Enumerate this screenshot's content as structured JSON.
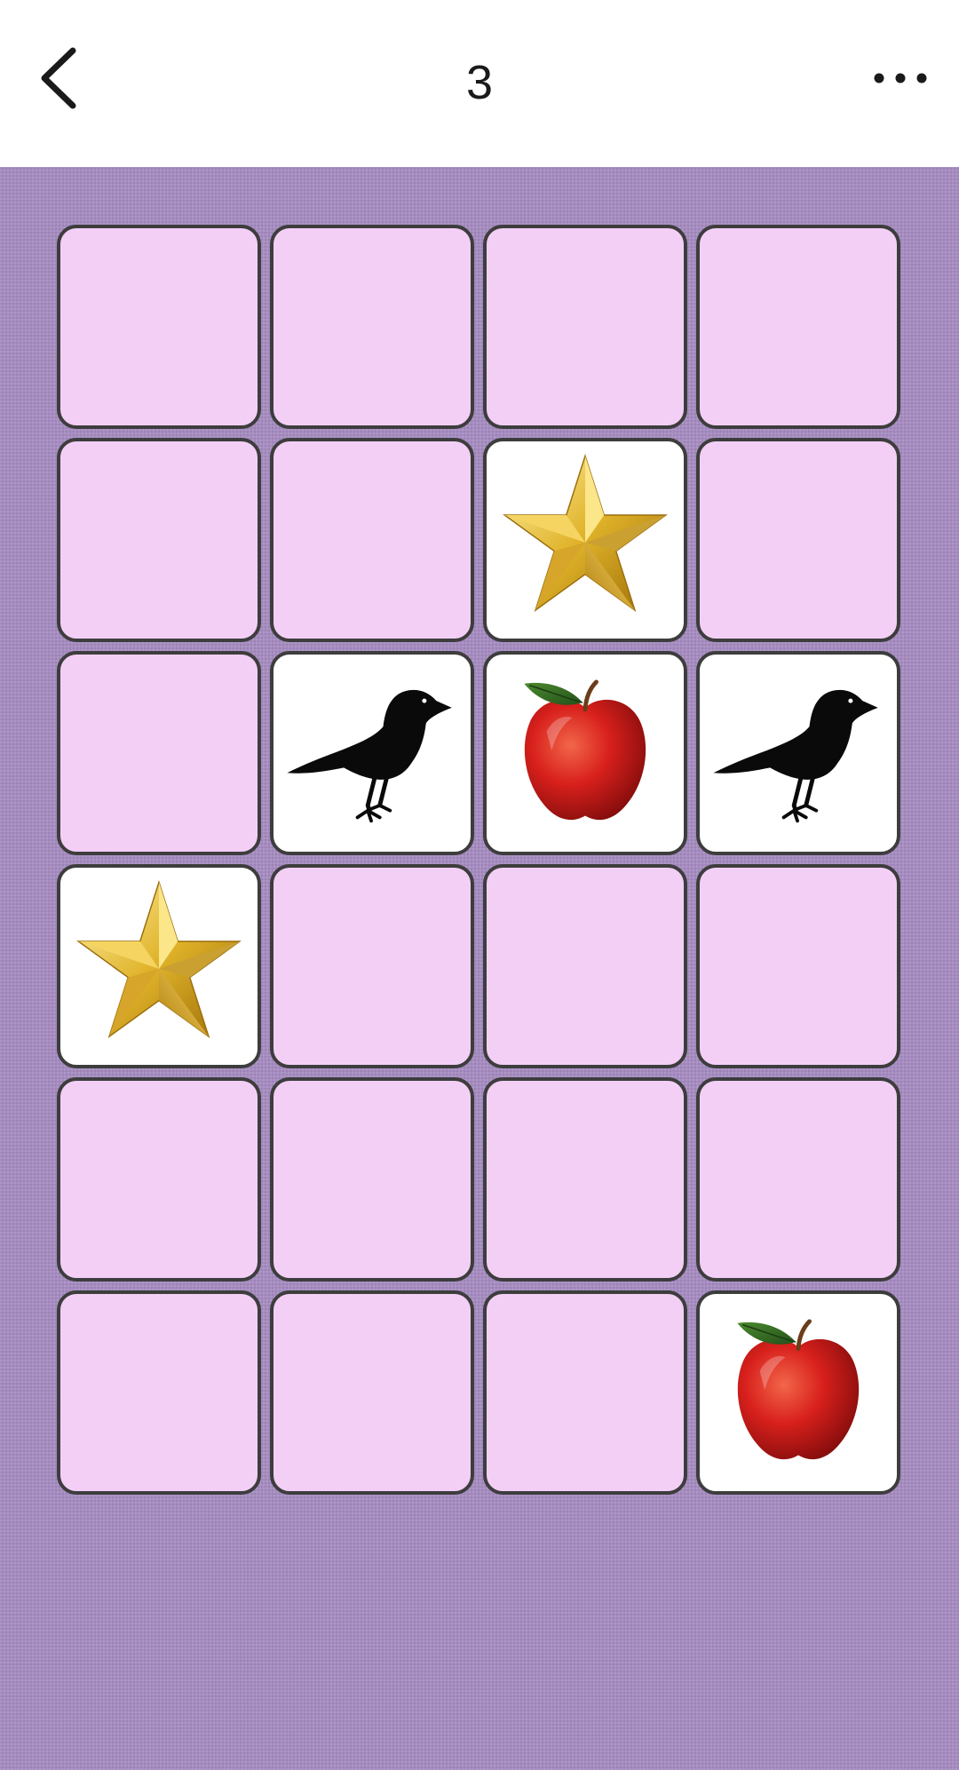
{
  "header": {
    "title": "3",
    "back_icon": "chevron-left-icon",
    "more_icon": "more-horizontal-icon"
  },
  "colors": {
    "board_background": "#a68bc2",
    "card_back": "#f3cff6",
    "card_face": "#ffffff",
    "card_border": "#3d3d3d"
  },
  "board": {
    "columns": 4,
    "rows": 6,
    "cards": [
      {
        "state": "hidden",
        "picture": ""
      },
      {
        "state": "hidden",
        "picture": ""
      },
      {
        "state": "hidden",
        "picture": ""
      },
      {
        "state": "hidden",
        "picture": ""
      },
      {
        "state": "hidden",
        "picture": ""
      },
      {
        "state": "hidden",
        "picture": ""
      },
      {
        "state": "revealed",
        "picture": "star"
      },
      {
        "state": "hidden",
        "picture": ""
      },
      {
        "state": "hidden",
        "picture": ""
      },
      {
        "state": "revealed",
        "picture": "crow"
      },
      {
        "state": "revealed",
        "picture": "apple"
      },
      {
        "state": "revealed",
        "picture": "crow"
      },
      {
        "state": "revealed",
        "picture": "star"
      },
      {
        "state": "hidden",
        "picture": ""
      },
      {
        "state": "hidden",
        "picture": ""
      },
      {
        "state": "hidden",
        "picture": ""
      },
      {
        "state": "hidden",
        "picture": ""
      },
      {
        "state": "hidden",
        "picture": ""
      },
      {
        "state": "hidden",
        "picture": ""
      },
      {
        "state": "hidden",
        "picture": ""
      },
      {
        "state": "hidden",
        "picture": ""
      },
      {
        "state": "hidden",
        "picture": ""
      },
      {
        "state": "hidden",
        "picture": ""
      },
      {
        "state": "revealed",
        "picture": "apple"
      }
    ]
  }
}
